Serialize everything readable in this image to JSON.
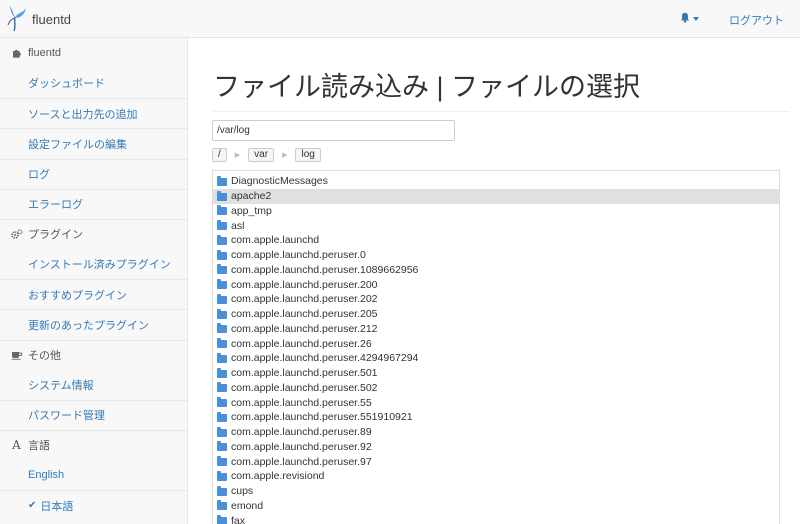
{
  "app": {
    "brand": "fluentd"
  },
  "header": {
    "logout_label": "ログアウト"
  },
  "sidebar": {
    "sections": [
      {
        "title": "fluentd",
        "items": [
          {
            "label": "ダッシュボード"
          },
          {
            "label": "ソースと出力先の追加"
          },
          {
            "label": "設定ファイルの編集"
          },
          {
            "label": "ログ"
          },
          {
            "label": "エラーログ"
          }
        ]
      },
      {
        "title": "プラグイン",
        "items": [
          {
            "label": "インストール済みプラグイン"
          },
          {
            "label": "おすすめプラグイン"
          },
          {
            "label": "更新のあったプラグイン"
          }
        ]
      },
      {
        "title": "その他",
        "items": [
          {
            "label": "システム情報"
          },
          {
            "label": "パスワード管理"
          }
        ]
      },
      {
        "title": "言語",
        "items": [
          {
            "label": "English"
          },
          {
            "label": "日本語"
          }
        ]
      }
    ]
  },
  "main": {
    "title": "ファイル読み込み | ファイルの選択",
    "path_value": "/var/log",
    "breadcrumbs": [
      "/",
      "var",
      "log"
    ],
    "selected_file": "apache2",
    "files": [
      "DiagnosticMessages",
      "apache2",
      "app_tmp",
      "asl",
      "com.apple.launchd",
      "com.apple.launchd.peruser.0",
      "com.apple.launchd.peruser.1089662956",
      "com.apple.launchd.peruser.200",
      "com.apple.launchd.peruser.202",
      "com.apple.launchd.peruser.205",
      "com.apple.launchd.peruser.212",
      "com.apple.launchd.peruser.26",
      "com.apple.launchd.peruser.4294967294",
      "com.apple.launchd.peruser.501",
      "com.apple.launchd.peruser.502",
      "com.apple.launchd.peruser.55",
      "com.apple.launchd.peruser.551910921",
      "com.apple.launchd.peruser.89",
      "com.apple.launchd.peruser.92",
      "com.apple.launchd.peruser.97",
      "com.apple.revisiond",
      "cups",
      "emond",
      "fax"
    ]
  },
  "colors": {
    "link": "#337ab7",
    "folder": "#4a90d9",
    "selected_row": "#e0e0e0"
  }
}
